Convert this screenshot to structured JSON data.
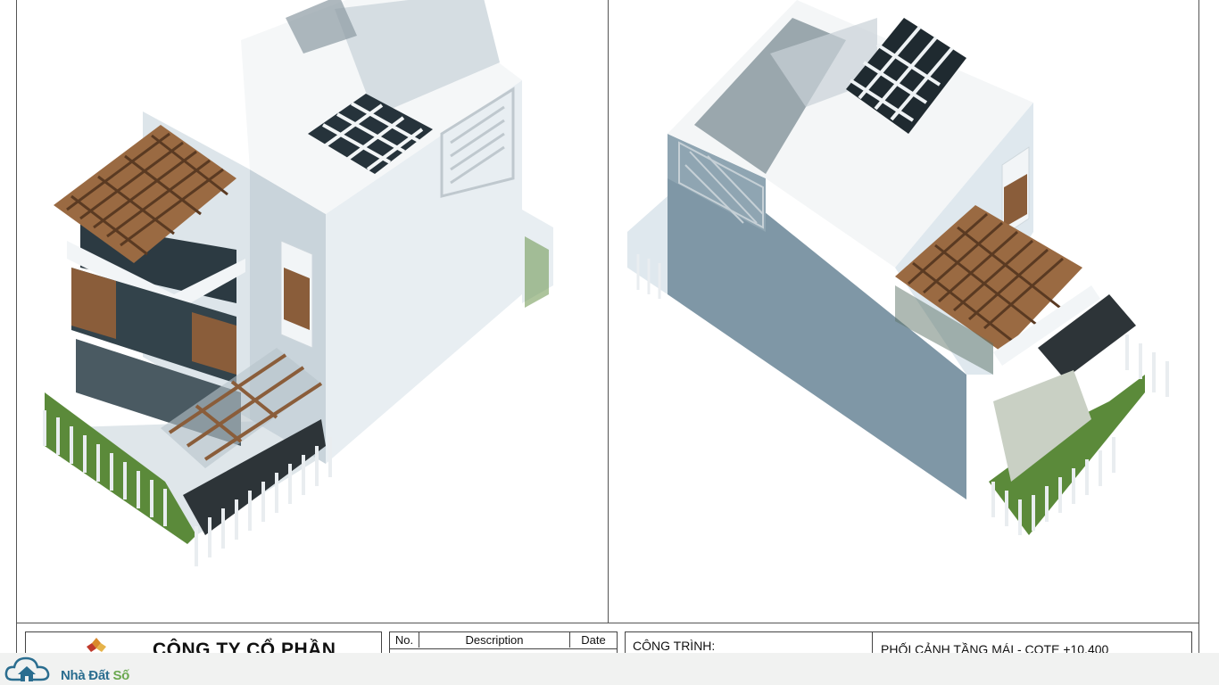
{
  "titleblock": {
    "company_name": "CÔNG TY CỔ PHẦN",
    "revision_table": {
      "headers": [
        "No.",
        "Description",
        "Date"
      ]
    },
    "project_label": "CÔNG TRÌNH:",
    "sheet_title": "PHỐI CẢNH TẦNG MÁI - COTE +10.400"
  },
  "watermark": {
    "brand_part1": "Nhà Đất ",
    "brand_part2": "Số"
  },
  "colors": {
    "wall": "#dfe8ee",
    "wall_shade": "#7f97a6",
    "wood": "#9a6a42",
    "glass": "#23313a",
    "grass": "#5b8a3a",
    "brand_blue": "#2a6d8f",
    "brand_green": "#6aa84f"
  }
}
